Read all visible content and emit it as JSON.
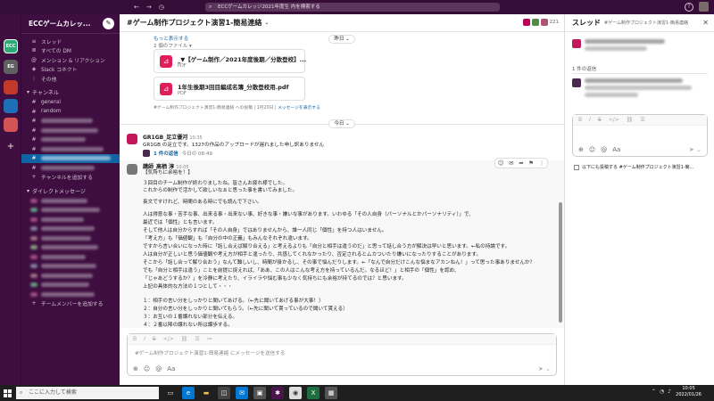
{
  "topbar": {
    "search": "ECCゲームカレッジ2021年度生 内を検索する",
    "help": "?"
  },
  "rail": {
    "ws": [
      "ECC",
      "EG",
      "",
      "",
      ""
    ]
  },
  "sidebar": {
    "title": "ECCゲームカレッ...",
    "items": [
      {
        "icon": "≡",
        "label": "スレッド"
      },
      {
        "icon": "≣",
        "label": "すべての DM"
      },
      {
        "icon": "@",
        "label": "メンション & リアクション"
      },
      {
        "icon": "◈",
        "label": "Slack コネクト"
      },
      {
        "icon": "⋮",
        "label": "その他"
      }
    ],
    "channels_header": "チャンネル",
    "channels": [
      "general",
      "random"
    ],
    "add_channel": "チャンネルを追加する",
    "dm_header": "ダイレクトメッセージ",
    "add_member": "チームメンバーを追加する"
  },
  "channel": {
    "name": "#ゲーム制作プロジェクト演習1-簡易連絡",
    "member_count": "221",
    "show_more": "もっと表示する",
    "file_count": "2 個のファイル",
    "files": [
      {
        "name": "_▼【ゲーム制作／2021年度後期／分散登校】...",
        "type": "PDF"
      },
      {
        "name": "1年生後期3回目編成名簿_分散登校用.pdf",
        "type": "PDF"
      }
    ],
    "shared_note": "#ゲーム制作プロジェクト演習1-簡易連絡 への投稿 | 1月20日 |",
    "shared_link": "メッセージを表示する",
    "pill_yesterday": "昨日",
    "pill_today": "今日",
    "msg1": {
      "author": "GR1GB_足立優河",
      "time": "10:35",
      "text": "GR1GB の足立です。1327の作品のアップロードが遅れました申し訳ありません",
      "reply": "1 件の返信",
      "reply_time": "今日の 08:49"
    },
    "msg2": {
      "author": "講師_高栖 淳",
      "time": "10:05",
      "lines": [
        "【気持ちに余裕を！】",
        "３回目のチーム制作が終わりましたね。皆さんお疲れ様でした。",
        "これからの制作で活かして欲しいなぁと思った事を書いてみました。",
        "長文ですけれど、時間のある時にでも読んで下さい。",
        "人は得意な事・苦手な事、出来る事・出来ない事、好きな事・嫌いな事があります。いわゆる「その人自身（パーソナルとかパーソナリティ）」で、",
        "最近では「個性」とも言います。",
        "そして他人は自分からすれば「その人自身」ではありませんから、誰一人同じ「個性」を持つ人はいません。",
        "「考え方」も「価値観」も「自分の中の正義」もみんなそれぞれ違います。",
        "ですから言い合いになった時に「話し合えば解り合える」と考えるよりも「自分と相手は違うのだ」と思って話し合う方が解決は早いと思います。←私の持論です。",
        "人は自分が正しいと思う価値観や考え方が相手と違ったり、共感してくれなかったり、否定されるとムカついたり嫌いになったりすることがあります。",
        "そこから「話し合って解り合おう」なんて難しいし、時間が掛かるし、その事で悩んだりします。←「なんで自分だけこんな悩まなアカンねん！」って思った事ありませんか？",
        "でも「自分と相手は違う」ことを前提に捉えれば、「ああ、この人はこんな考え方を持っているんだ。なるほど！」と相手の「個性」を認め、",
        "「じゃあどうするか？」を冷静に考えたり、イライラや悩む事も少なく気持ちにも余裕が持てるのでは？と思います。",
        "上記の具体的な方法の１つとして・・・",
        "１：相手の言い分をしっかりと聞いてあげる。（←先に聞いてあげる事が大事！）",
        "２：自分の言い分をしっかりと聞いてもらう。（←先に聞いて貰っているので聞いて貰える）",
        "３：お互いの１番譲れない部分を伝える。",
        "４：２番以降の譲れない所は譲歩する。"
      ]
    },
    "composer_placeholder": "#ゲーム制作プロジェクト演習1-簡易連絡 にメッセージを送信する"
  },
  "thread": {
    "title": "スレッド",
    "subtitle": "#ゲーム制作プロジェクト演習1-簡易連絡",
    "reply_count": "1 件の返信",
    "also_send": "以下にも投稿する #ゲーム制作プロジェクト演習1-簡..."
  },
  "taskbar": {
    "search": "ここに入力して検索",
    "time": "10:05",
    "date": "2022/01/26"
  }
}
